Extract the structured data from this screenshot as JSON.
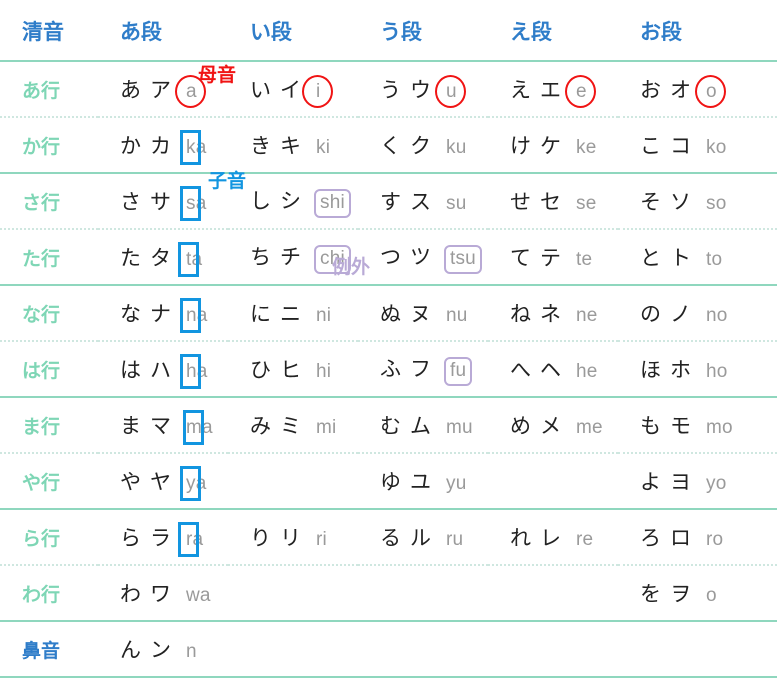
{
  "header": {
    "columns": [
      {
        "label": "清音"
      },
      {
        "label": "あ段"
      },
      {
        "label": "い段"
      },
      {
        "label": "う段"
      },
      {
        "label": "え段"
      },
      {
        "label": "お段"
      }
    ]
  },
  "annotations": {
    "vowel": "母音",
    "consonant": "子音",
    "exception": "例外"
  },
  "colors": {
    "header_blue": "#2f7dc9",
    "row_label_green": "#7ed6b5",
    "romaji_gray": "#9a9a9a",
    "kana_black": "#222222",
    "circle_red": "#f01414",
    "box_cyan": "#1295e0",
    "exception_lavender": "#b9aad6",
    "border_solid_green": "#8fd7be",
    "border_dotted": "#cfe7e0"
  },
  "rows": [
    {
      "label": "あ行",
      "label_accent": "green",
      "separator": "dotted",
      "cells": [
        {
          "hiragana": "あ",
          "katakana": "ア",
          "romaji": "a",
          "mark": "circle"
        },
        {
          "hiragana": "い",
          "katakana": "イ",
          "romaji": "i",
          "mark": "circle"
        },
        {
          "hiragana": "う",
          "katakana": "ウ",
          "romaji": "u",
          "mark": "circle"
        },
        {
          "hiragana": "え",
          "katakana": "エ",
          "romaji": "e",
          "mark": "circle"
        },
        {
          "hiragana": "お",
          "katakana": "オ",
          "romaji": "o",
          "mark": "circle"
        }
      ]
    },
    {
      "label": "か行",
      "label_accent": "green",
      "separator": "solid",
      "cells": [
        {
          "hiragana": "か",
          "katakana": "カ",
          "romaji": "ka",
          "mark": "consonant",
          "consonant": "k",
          "rest": "a"
        },
        {
          "hiragana": "き",
          "katakana": "キ",
          "romaji": "ki",
          "mark": "none"
        },
        {
          "hiragana": "く",
          "katakana": "ク",
          "romaji": "ku",
          "mark": "none"
        },
        {
          "hiragana": "け",
          "katakana": "ケ",
          "romaji": "ke",
          "mark": "none"
        },
        {
          "hiragana": "こ",
          "katakana": "コ",
          "romaji": "ko",
          "mark": "none"
        }
      ]
    },
    {
      "label": "さ行",
      "label_accent": "green",
      "separator": "dotted",
      "cells": [
        {
          "hiragana": "さ",
          "katakana": "サ",
          "romaji": "sa",
          "mark": "consonant",
          "consonant": "s",
          "rest": "a"
        },
        {
          "hiragana": "し",
          "katakana": "シ",
          "romaji": "shi",
          "mark": "box"
        },
        {
          "hiragana": "す",
          "katakana": "ス",
          "romaji": "su",
          "mark": "none"
        },
        {
          "hiragana": "せ",
          "katakana": "セ",
          "romaji": "se",
          "mark": "none"
        },
        {
          "hiragana": "そ",
          "katakana": "ソ",
          "romaji": "so",
          "mark": "none"
        }
      ]
    },
    {
      "label": "た行",
      "label_accent": "green",
      "separator": "solid",
      "cells": [
        {
          "hiragana": "た",
          "katakana": "タ",
          "romaji": "ta",
          "mark": "consonant",
          "consonant": "t",
          "rest": "a"
        },
        {
          "hiragana": "ち",
          "katakana": "チ",
          "romaji": "chi",
          "mark": "box"
        },
        {
          "hiragana": "つ",
          "katakana": "ツ",
          "romaji": "tsu",
          "mark": "box"
        },
        {
          "hiragana": "て",
          "katakana": "テ",
          "romaji": "te",
          "mark": "none"
        },
        {
          "hiragana": "と",
          "katakana": "ト",
          "romaji": "to",
          "mark": "none"
        }
      ]
    },
    {
      "label": "な行",
      "label_accent": "green",
      "separator": "dotted",
      "cells": [
        {
          "hiragana": "な",
          "katakana": "ナ",
          "romaji": "na",
          "mark": "consonant",
          "consonant": "n",
          "rest": "a"
        },
        {
          "hiragana": "に",
          "katakana": "ニ",
          "romaji": "ni",
          "mark": "none"
        },
        {
          "hiragana": "ぬ",
          "katakana": "ヌ",
          "romaji": "nu",
          "mark": "none"
        },
        {
          "hiragana": "ね",
          "katakana": "ネ",
          "romaji": "ne",
          "mark": "none"
        },
        {
          "hiragana": "の",
          "katakana": "ノ",
          "romaji": "no",
          "mark": "none"
        }
      ]
    },
    {
      "label": "は行",
      "label_accent": "green",
      "separator": "solid",
      "cells": [
        {
          "hiragana": "は",
          "katakana": "ハ",
          "romaji": "ha",
          "mark": "consonant",
          "consonant": "h",
          "rest": "a"
        },
        {
          "hiragana": "ひ",
          "katakana": "ヒ",
          "romaji": "hi",
          "mark": "none"
        },
        {
          "hiragana": "ふ",
          "katakana": "フ",
          "romaji": "fu",
          "mark": "box"
        },
        {
          "hiragana": "へ",
          "katakana": "ヘ",
          "romaji": "he",
          "mark": "none"
        },
        {
          "hiragana": "ほ",
          "katakana": "ホ",
          "romaji": "ho",
          "mark": "none"
        }
      ]
    },
    {
      "label": "ま行",
      "label_accent": "green",
      "separator": "dotted",
      "cells": [
        {
          "hiragana": "ま",
          "katakana": "マ",
          "romaji": "ma",
          "mark": "consonant",
          "consonant": "m",
          "rest": "a"
        },
        {
          "hiragana": "み",
          "katakana": "ミ",
          "romaji": "mi",
          "mark": "none"
        },
        {
          "hiragana": "む",
          "katakana": "ム",
          "romaji": "mu",
          "mark": "none"
        },
        {
          "hiragana": "め",
          "katakana": "メ",
          "romaji": "me",
          "mark": "none"
        },
        {
          "hiragana": "も",
          "katakana": "モ",
          "romaji": "mo",
          "mark": "none"
        }
      ]
    },
    {
      "label": "や行",
      "label_accent": "green",
      "separator": "solid",
      "cells": [
        {
          "hiragana": "や",
          "katakana": "ヤ",
          "romaji": "ya",
          "mark": "consonant",
          "consonant": "y",
          "rest": "a"
        },
        {
          "hiragana": "",
          "katakana": "",
          "romaji": "",
          "mark": "none"
        },
        {
          "hiragana": "ゆ",
          "katakana": "ユ",
          "romaji": "yu",
          "mark": "none"
        },
        {
          "hiragana": "",
          "katakana": "",
          "romaji": "",
          "mark": "none"
        },
        {
          "hiragana": "よ",
          "katakana": "ヨ",
          "romaji": "yo",
          "mark": "none"
        }
      ]
    },
    {
      "label": "ら行",
      "label_accent": "green",
      "separator": "dotted",
      "cells": [
        {
          "hiragana": "ら",
          "katakana": "ラ",
          "romaji": "ra",
          "mark": "consonant",
          "consonant": "r",
          "rest": "a"
        },
        {
          "hiragana": "り",
          "katakana": "リ",
          "romaji": "ri",
          "mark": "none"
        },
        {
          "hiragana": "る",
          "katakana": "ル",
          "romaji": "ru",
          "mark": "none"
        },
        {
          "hiragana": "れ",
          "katakana": "レ",
          "romaji": "re",
          "mark": "none"
        },
        {
          "hiragana": "ろ",
          "katakana": "ロ",
          "romaji": "ro",
          "mark": "none"
        }
      ]
    },
    {
      "label": "わ行",
      "label_accent": "green",
      "separator": "solid",
      "cells": [
        {
          "hiragana": "わ",
          "katakana": "ワ",
          "romaji": "wa",
          "mark": "none"
        },
        {
          "hiragana": "",
          "katakana": "",
          "romaji": "",
          "mark": "none"
        },
        {
          "hiragana": "",
          "katakana": "",
          "romaji": "",
          "mark": "none"
        },
        {
          "hiragana": "",
          "katakana": "",
          "romaji": "",
          "mark": "none"
        },
        {
          "hiragana": "を",
          "katakana": "ヲ",
          "romaji": "o",
          "mark": "none"
        }
      ]
    },
    {
      "label": "鼻音",
      "label_accent": "blue",
      "separator": "solid",
      "cells": [
        {
          "hiragana": "ん",
          "katakana": "ン",
          "romaji": "n",
          "mark": "none"
        },
        {
          "hiragana": "",
          "katakana": "",
          "romaji": "",
          "mark": "none"
        },
        {
          "hiragana": "",
          "katakana": "",
          "romaji": "",
          "mark": "none"
        },
        {
          "hiragana": "",
          "katakana": "",
          "romaji": "",
          "mark": "none"
        },
        {
          "hiragana": "",
          "katakana": "",
          "romaji": "",
          "mark": "none"
        }
      ]
    }
  ]
}
